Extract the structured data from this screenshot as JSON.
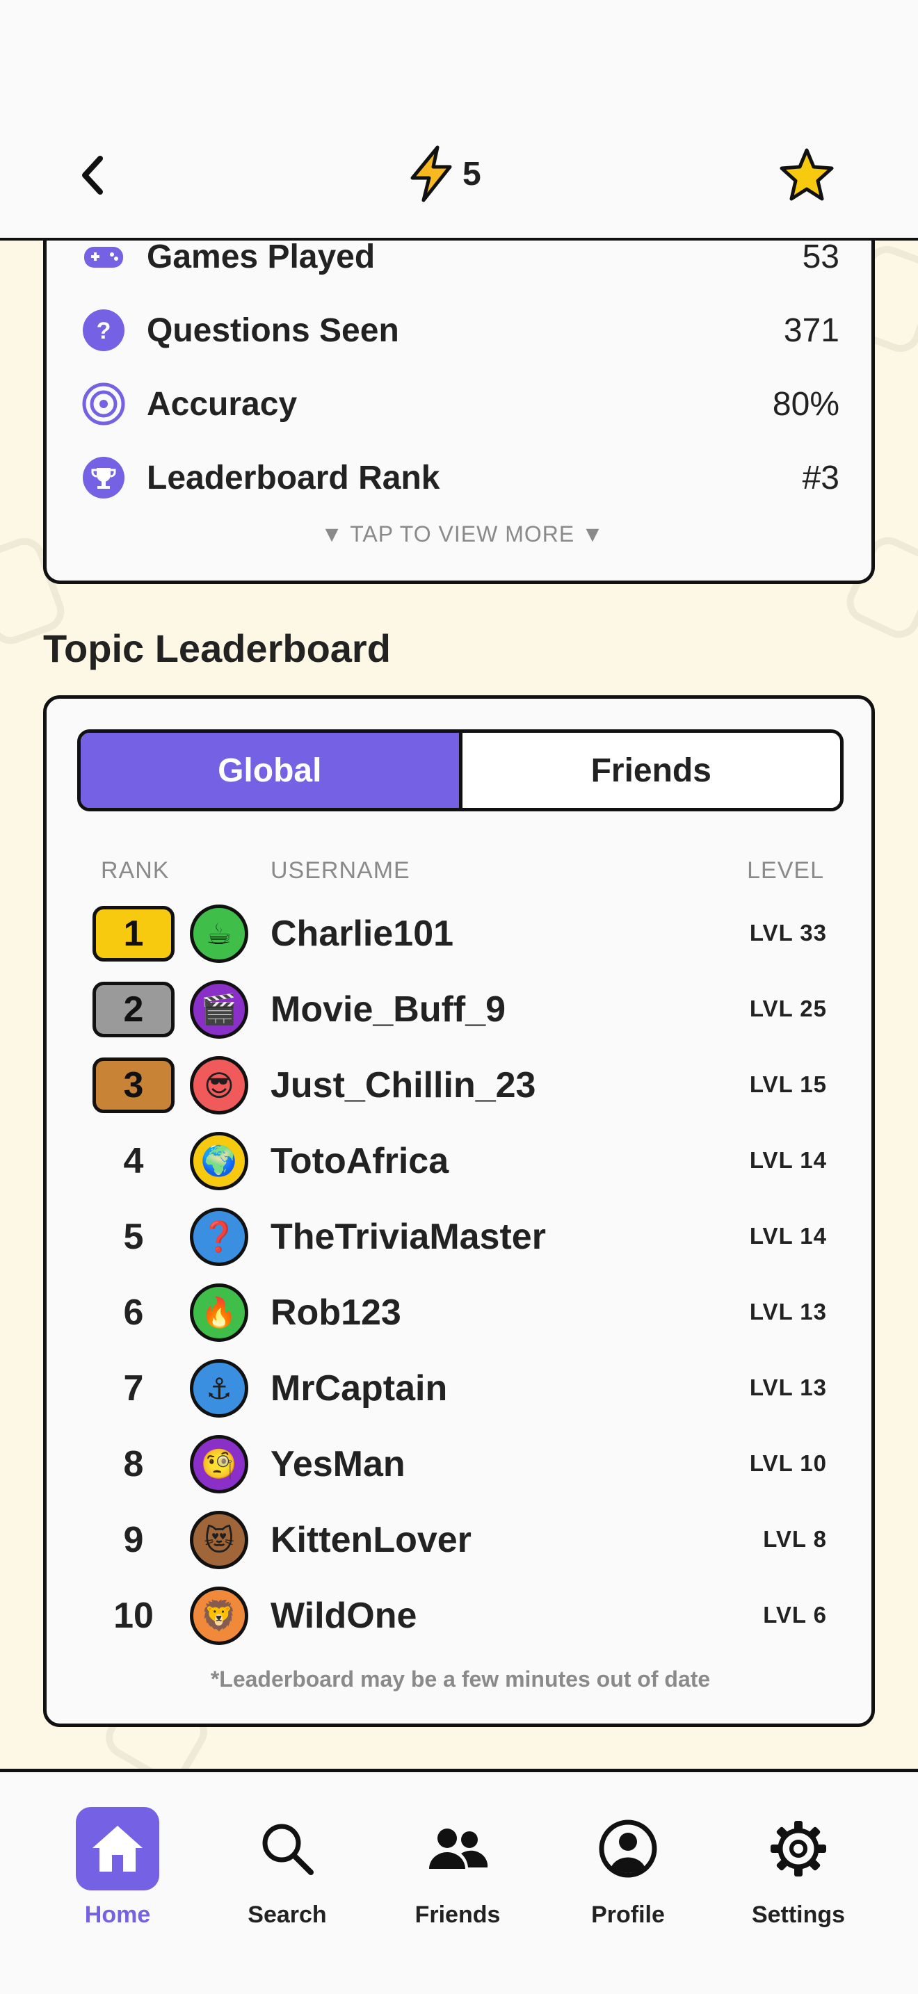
{
  "header": {
    "energy_count": "5"
  },
  "stats": {
    "rows": [
      {
        "label": "Games Played",
        "value": "53"
      },
      {
        "label": "Questions Seen",
        "value": "371"
      },
      {
        "label": "Accuracy",
        "value": "80%"
      },
      {
        "label": "Leaderboard Rank",
        "value": "#3"
      }
    ],
    "tap_more": "▼ TAP TO VIEW MORE ▼"
  },
  "leaderboard": {
    "title": "Topic Leaderboard",
    "tabs": {
      "global": "Global",
      "friends": "Friends"
    },
    "columns": {
      "rank": "RANK",
      "username": "USERNAME",
      "level": "LEVEL"
    },
    "rows": [
      {
        "rank": "1",
        "emoji": "☕",
        "name": "Charlie101",
        "level": "LVL 33"
      },
      {
        "rank": "2",
        "emoji": "🎬",
        "name": "Movie_Buff_9",
        "level": "LVL 25"
      },
      {
        "rank": "3",
        "emoji": "😎",
        "name": "Just_Chillin_23",
        "level": "LVL 15"
      },
      {
        "rank": "4",
        "emoji": "🌍",
        "name": "TotoAfrica",
        "level": "LVL 14"
      },
      {
        "rank": "5",
        "emoji": "❓",
        "name": "TheTriviaMaster",
        "level": "LVL 14"
      },
      {
        "rank": "6",
        "emoji": "🔥",
        "name": "Rob123",
        "level": "LVL 13"
      },
      {
        "rank": "7",
        "emoji": "⚓",
        "name": "MrCaptain",
        "level": "LVL 13"
      },
      {
        "rank": "8",
        "emoji": "🧐",
        "name": "YesMan",
        "level": "LVL 10"
      },
      {
        "rank": "9",
        "emoji": "😻",
        "name": "KittenLover",
        "level": "LVL 8"
      },
      {
        "rank": "10",
        "emoji": "🦁",
        "name": "WildOne",
        "level": "LVL 6"
      }
    ],
    "footnote": "*Leaderboard may be a few minutes out of date"
  },
  "nav": {
    "home": "Home",
    "search": "Search",
    "friends": "Friends",
    "profile": "Profile",
    "settings": "Settings"
  },
  "colors": {
    "accent": "#7461e3",
    "gold": "#f7c90f",
    "silver": "#9a9a9a",
    "bronze": "#c98336",
    "background": "#fdf8e6"
  }
}
